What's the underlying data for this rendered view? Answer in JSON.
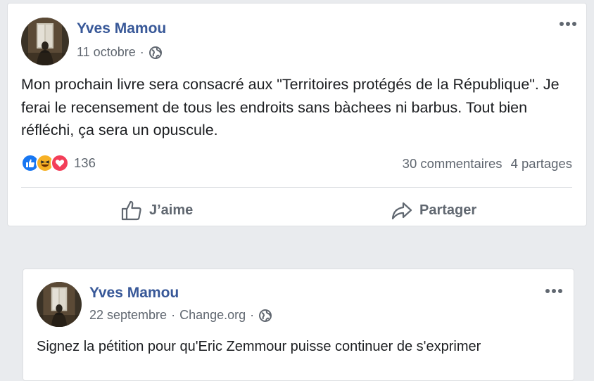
{
  "post1": {
    "author": "Yves Mamou",
    "date": "11 octobre",
    "separator": "·",
    "text": "Mon prochain livre sera consacré aux \"Territoires protégés de la République\". Je ferai le recensement de tous les endroits sans bàchees ni barbus. Tout bien réfléchi, ça sera un opuscule.",
    "reactions": [
      "like",
      "haha",
      "love"
    ],
    "reaction_count": "136",
    "comments": "30 commentaires",
    "shares": "4 partages",
    "like_label": "J’aime",
    "share_label": "Partager"
  },
  "post2": {
    "author": "Yves Mamou",
    "date": "22 septembre",
    "separator": "·",
    "source": "Change.org",
    "text": "Signez la pétition pour qu'Eric Zemmour puisse continuer de s'exprimer"
  },
  "colors": {
    "author": "#385898",
    "meta": "#606770",
    "like_blue": "#1877f2",
    "haha_yellow": "#f7b125",
    "love_red": "#f33e58",
    "background": "#e9ebee"
  },
  "icons": [
    "globe-icon",
    "more-icon",
    "like-reaction-icon",
    "haha-reaction-icon",
    "love-reaction-icon",
    "thumbs-up-icon",
    "share-arrow-icon"
  ]
}
